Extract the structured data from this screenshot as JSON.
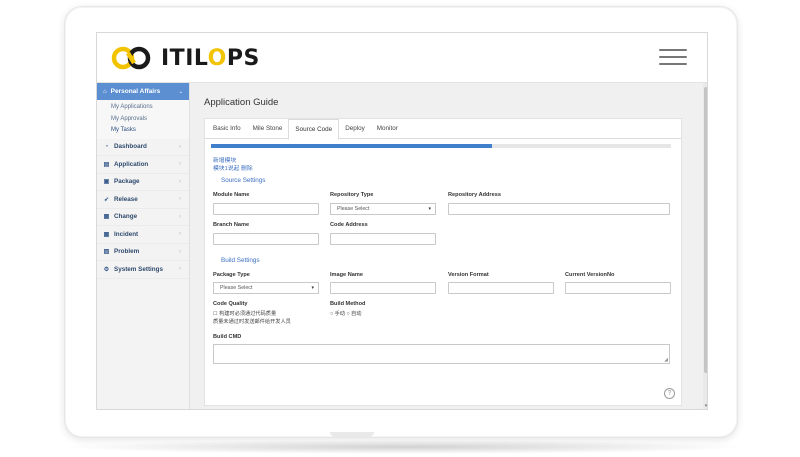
{
  "brand": {
    "name_prefix": "ITIL",
    "name_o": "O",
    "name_suffix": "PS"
  },
  "sidebar": {
    "header": "Personal Affairs",
    "sub_items": [
      "My Applications",
      "My Approvals",
      "My Tasks"
    ],
    "items": [
      {
        "label": "Dashboard",
        "icon": "dashboard-icon"
      },
      {
        "label": "Application",
        "icon": "application-icon"
      },
      {
        "label": "Package",
        "icon": "package-icon"
      },
      {
        "label": "Release",
        "icon": "release-icon"
      },
      {
        "label": "Change",
        "icon": "change-icon"
      },
      {
        "label": "Incident",
        "icon": "incident-icon"
      },
      {
        "label": "Problem",
        "icon": "problem-icon"
      },
      {
        "label": "System Settings",
        "icon": "gear-icon"
      }
    ]
  },
  "main": {
    "title": "Application Guide",
    "tabs": [
      "Basic Info",
      "Mile Stone",
      "Source Code",
      "Deploy",
      "Monitor"
    ],
    "active_tab": "Source Code",
    "progress": 0.61,
    "links": [
      "新增模块",
      "模块1说起 删除"
    ],
    "source_settings": {
      "title": "Source Settings",
      "module_name_label": "Module Name",
      "repository_type_label": "Repository Type",
      "repository_type_value": "Please Select",
      "repository_address_label": "Repository Address",
      "branch_name_label": "Branch Name",
      "code_address_label": "Code Address"
    },
    "build_settings": {
      "title": "Build Settings",
      "package_type_label": "Package Type",
      "package_type_value": "Please Select",
      "image_name_label": "Image Name",
      "version_format_label": "Version Format",
      "current_version_label": "Current VersionNo",
      "code_quality_label": "Code Quality",
      "code_quality_note_1": "构建时必须通过代码质量",
      "code_quality_note_2": "质量未通过时发送邮件给开发人员",
      "build_method_label": "Build Method",
      "build_method_option_1": "手动",
      "build_method_option_2": "自动",
      "build_cmd_label": "Build CMD"
    }
  },
  "colors": {
    "accent": "#3f7fcc",
    "sidebar_header": "#5b8fd1",
    "logo_yellow": "#f2c300"
  }
}
